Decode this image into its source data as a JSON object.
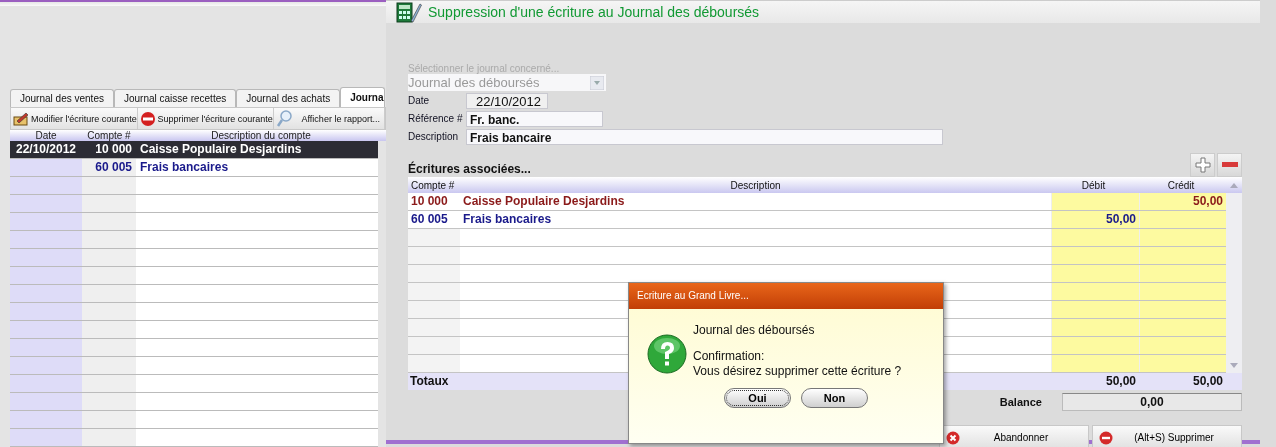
{
  "left_panel": {
    "tabs": [
      {
        "label": "Journal des ventes",
        "selected": false
      },
      {
        "label": "Journal caisse recettes",
        "selected": false
      },
      {
        "label": "Journal des achats",
        "selected": false
      },
      {
        "label": "Journa",
        "selected": true
      }
    ],
    "toolbar": [
      {
        "kind": "edit",
        "label": "Modifier l'écriture courante"
      },
      {
        "kind": "delete",
        "label": "Supprimer l'écriture courante"
      },
      {
        "kind": "search",
        "label": "Afficher le rapport..."
      }
    ],
    "table": {
      "columns": [
        "Date",
        "Compte #",
        "Description du compte"
      ],
      "rows": [
        {
          "date": "22/10/2012",
          "account": "10 000",
          "description": "Caisse Populaire Desjardins",
          "selected": true
        },
        {
          "account": "60 005",
          "description": "Frais bancaires",
          "selected": false
        }
      ]
    }
  },
  "form": {
    "title": "Suppression d'une écriture au Journal des déboursés",
    "journal_select": {
      "label": "Sélectionner le journal concerné...",
      "value": "Journal des déboursés",
      "disabled": true
    },
    "fields": [
      {
        "label": "Date",
        "value": "22/10/2012",
        "kind": "short"
      },
      {
        "label": "Référence #",
        "value": "Fr. banc.",
        "kind": "medium"
      },
      {
        "label": "Description",
        "value": "Frais bancaire",
        "kind": "long"
      }
    ],
    "entries_heading": "Écritures associées...",
    "table": {
      "columns": [
        "Compte #",
        "Description",
        "Débit",
        "Crédit"
      ],
      "rows": [
        {
          "account": "10 000",
          "description": "Caisse Populaire Desjardins",
          "credit": "50,00",
          "color": "#8b1a1a"
        },
        {
          "account": "60 005",
          "description": "Frais bancaires",
          "debit": "50,00",
          "color": "#1a1a8b"
        }
      ],
      "totals_label": "Totaux",
      "total_debit": "50,00",
      "total_credit": "50,00"
    },
    "balance_label": "Balance",
    "balance": "0,00",
    "buttons": [
      {
        "kind": "cancel",
        "label": "Abandonner"
      },
      {
        "kind": "delete",
        "label": "(Alt+S)  Supprimer"
      }
    ]
  },
  "dialog": {
    "title": "Ecriture au Grand Livre...",
    "heading": "Journal des déboursés",
    "message": [
      "Confirmation:",
      "Vous désirez supprimer cette écriture ?"
    ],
    "buttons": [
      {
        "label": "Oui",
        "focused": true
      },
      {
        "label": "Non",
        "focused": false
      }
    ]
  }
}
